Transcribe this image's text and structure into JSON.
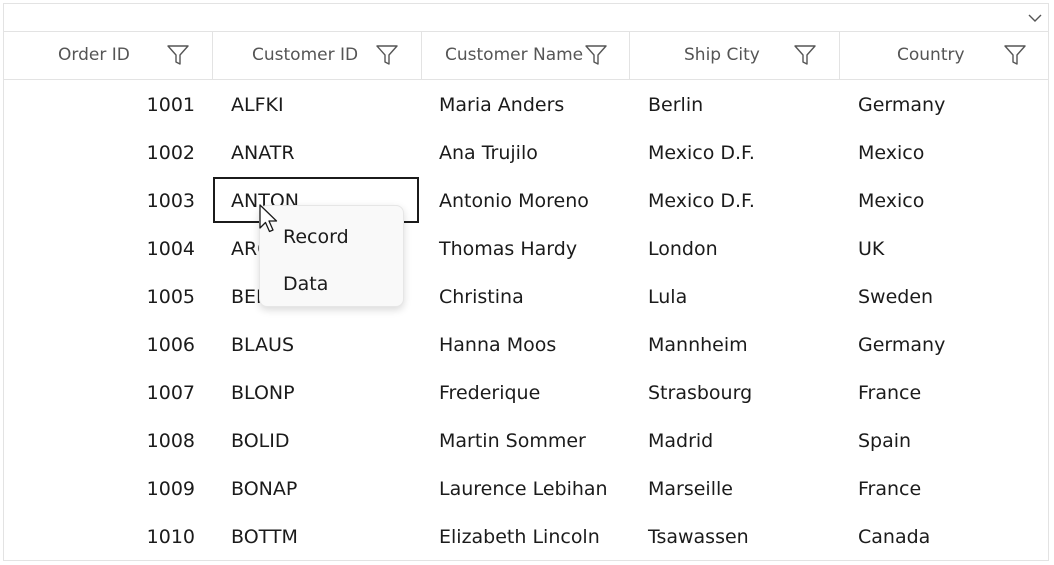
{
  "grid": {
    "columns": [
      {
        "key": "order",
        "label": "Order ID"
      },
      {
        "key": "customer",
        "label": "Customer ID"
      },
      {
        "key": "name",
        "label": "Customer Name"
      },
      {
        "key": "city",
        "label": "Ship City"
      },
      {
        "key": "country",
        "label": "Country"
      }
    ],
    "rows": [
      {
        "order": "1001",
        "customer": "ALFKI",
        "name": "Maria Anders",
        "city": "Berlin",
        "country": "Germany"
      },
      {
        "order": "1002",
        "customer": "ANATR",
        "name": "Ana Trujilo",
        "city": "Mexico D.F.",
        "country": "Mexico"
      },
      {
        "order": "1003",
        "customer": "ANTON",
        "name": "Antonio Moreno",
        "city": "Mexico D.F.",
        "country": "Mexico"
      },
      {
        "order": "1004",
        "customer": "AROUT",
        "name": "Thomas Hardy",
        "city": "London",
        "country": "UK"
      },
      {
        "order": "1005",
        "customer": "BERGS",
        "name": "Christina",
        "city": "Lula",
        "country": "Sweden"
      },
      {
        "order": "1006",
        "customer": "BLAUS",
        "name": "Hanna Moos",
        "city": "Mannheim",
        "country": "Germany"
      },
      {
        "order": "1007",
        "customer": "BLONP",
        "name": "Frederique",
        "city": "Strasbourg",
        "country": "France"
      },
      {
        "order": "1008",
        "customer": "BOLID",
        "name": "Martin Sommer",
        "city": "Madrid",
        "country": "Spain"
      },
      {
        "order": "1009",
        "customer": "BONAP",
        "name": "Laurence Lebihan",
        "city": "Marseille",
        "country": "France"
      },
      {
        "order": "1010",
        "customer": "BOTTM",
        "name": "Elizabeth Lincoln",
        "city": "Tsawassen",
        "country": "Canada"
      }
    ]
  },
  "context_menu": {
    "items": [
      "Record",
      "Data"
    ]
  },
  "colors": {
    "border": "#e3e3e3",
    "header_text": "#555555",
    "cell_text": "#1b1b1b",
    "menu_bg": "#f9f9f9"
  },
  "icons": {
    "filter": "filter-icon",
    "expand": "chevron-down-icon",
    "pointer": "mouse-pointer-icon"
  }
}
